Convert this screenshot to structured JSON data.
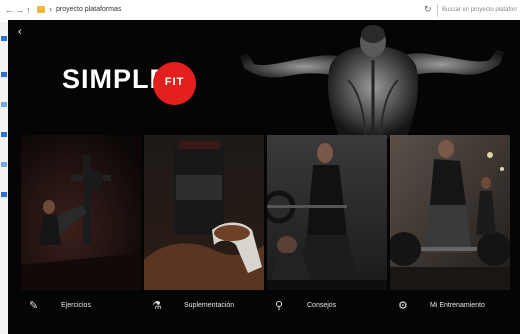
{
  "explorer": {
    "nav_back": "←",
    "nav_forward": "→",
    "nav_up": "↑",
    "separator": "›",
    "path": "proyecto plataformas",
    "refresh": "↻",
    "search_placeholder": "Buscar en proyecto plataformas"
  },
  "app": {
    "back_glyph": "‹",
    "close_glyph": "✕",
    "logo": {
      "word": "SIMPLE",
      "badge": "FIT",
      "badge_color": "#e4201e"
    },
    "cards": [
      {
        "label": "Ejercicios",
        "icon": "dumbbell-icon",
        "glyph": "✎"
      },
      {
        "label": "Suplementación",
        "icon": "supplement-icon",
        "glyph": "⚗"
      },
      {
        "label": "Consejos",
        "icon": "advice-icon",
        "glyph": "⚲"
      },
      {
        "label": "Mi Entrenamiento",
        "icon": "training-icon",
        "glyph": "⚙"
      }
    ]
  }
}
